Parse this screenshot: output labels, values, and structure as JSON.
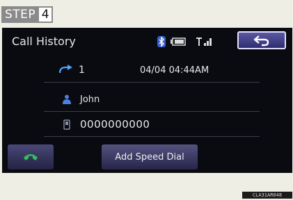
{
  "step": {
    "word": "STEP",
    "number": "4"
  },
  "screen": {
    "title": "Call History",
    "status_icons": [
      "bluetooth-icon",
      "battery-icon",
      "signal-icon"
    ],
    "back_icon": "return-arrow-icon"
  },
  "entry": {
    "direction_icon": "outgoing-call-icon",
    "count": "1",
    "datetime": "04/04 04:44AM",
    "contact_icon": "person-icon",
    "name": "John",
    "phone_icon": "mobile-phone-icon",
    "number": "0000000000"
  },
  "buttons": {
    "call_icon": "phone-handset-icon",
    "speed_dial_label": "Add Speed Dial"
  },
  "figure_code": "CLA31AR048",
  "colors": {
    "accent": "#4f4c98",
    "call_green": "#2fc25b",
    "screen_bg": "#090b10",
    "page_bg": "#eeeee4"
  }
}
